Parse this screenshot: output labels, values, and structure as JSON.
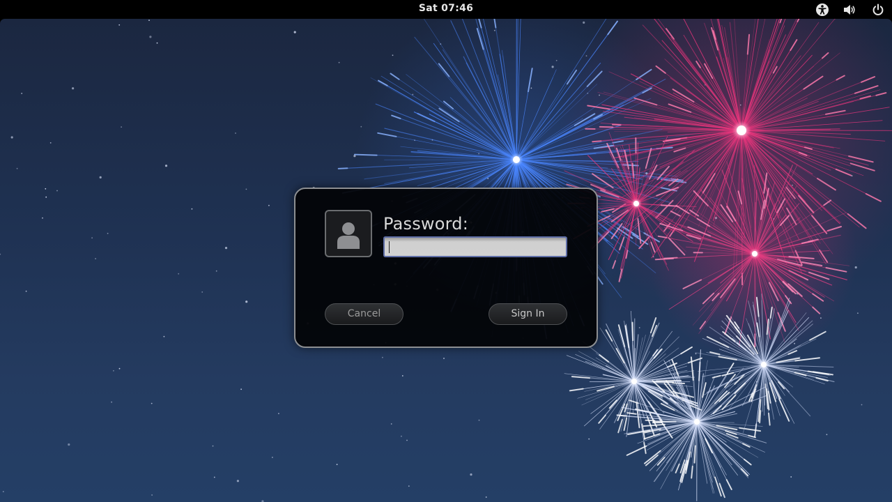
{
  "top_bar": {
    "clock": "Sat 07:46",
    "icons": {
      "accessibility": "accessibility-icon",
      "volume": "volume-icon",
      "power": "power-icon"
    }
  },
  "wallpaper": {
    "description_icon": "fireworks-wallpaper",
    "colors": {
      "sky_top": "#1b2740",
      "sky_bottom": "#243f66",
      "blue_burst": "#4a86ff",
      "pink_burst": "#e8357c",
      "white_burst": "#dde6ff"
    }
  },
  "login": {
    "avatar_icon": "user-avatar-icon",
    "prompt_label": "Password:",
    "password_value": "",
    "cancel_label": "Cancel",
    "sign_in_label": "Sign In",
    "colors": {
      "dialog_bg": "#030407",
      "dialog_border": "#8d8f92",
      "field_focus_border": "#5f6ea7"
    }
  }
}
